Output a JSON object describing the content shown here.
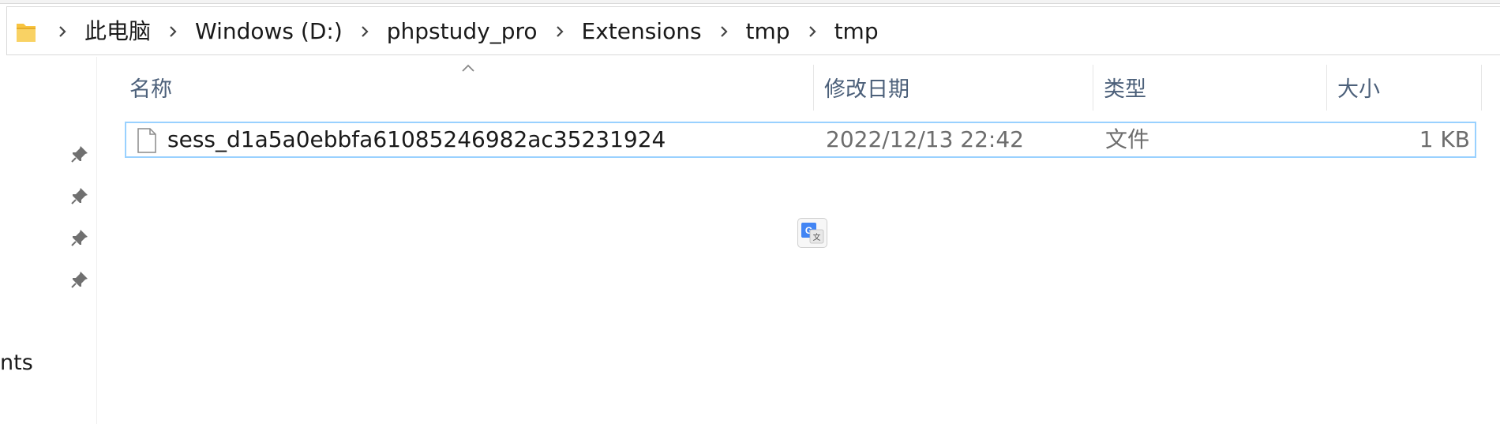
{
  "breadcrumb": {
    "items": [
      {
        "label": "此电脑"
      },
      {
        "label": "Windows (D:)"
      },
      {
        "label": "phpstudy_pro"
      },
      {
        "label": "Extensions"
      },
      {
        "label": "tmp"
      },
      {
        "label": "tmp"
      }
    ]
  },
  "columns": {
    "name": "名称",
    "modified": "修改日期",
    "type": "类型",
    "size": "大小",
    "sort_indicator": "ascending"
  },
  "files": [
    {
      "name": "sess_d1a5a0ebbfa61085246982ac35231924",
      "modified": "2022/12/13 22:42",
      "type": "文件",
      "size": "1 KB",
      "icon": "document-icon"
    }
  ],
  "nav_pane": {
    "pinned_count": 4,
    "partial_label": "nts"
  },
  "colors": {
    "selection_border": "#99d1ff",
    "header_text": "#4c607a",
    "folder": "#f8c440",
    "translate_blue": "#4285f4"
  }
}
